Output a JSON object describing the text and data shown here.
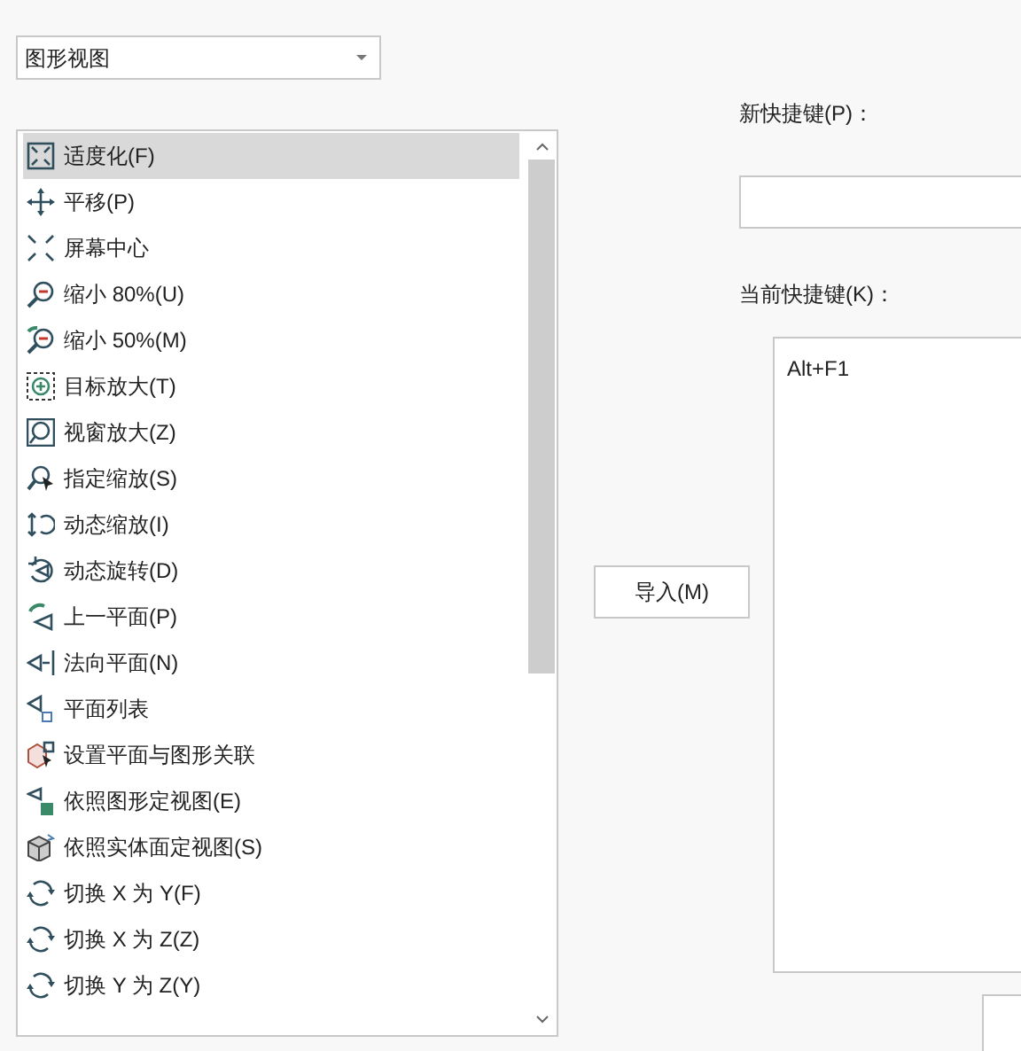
{
  "view_dropdown": {
    "value": "图形视图"
  },
  "command_list": {
    "items": [
      {
        "label": "适度化(F)",
        "selected": true
      },
      {
        "label": "平移(P)",
        "selected": false
      },
      {
        "label": "屏幕中心",
        "selected": false
      },
      {
        "label": "缩小 80%(U)",
        "selected": false
      },
      {
        "label": "缩小 50%(M)",
        "selected": false
      },
      {
        "label": "目标放大(T)",
        "selected": false
      },
      {
        "label": "视窗放大(Z)",
        "selected": false
      },
      {
        "label": "指定缩放(S)",
        "selected": false
      },
      {
        "label": "动态缩放(I)",
        "selected": false
      },
      {
        "label": "动态旋转(D)",
        "selected": false
      },
      {
        "label": "上一平面(P)",
        "selected": false
      },
      {
        "label": "法向平面(N)",
        "selected": false
      },
      {
        "label": "平面列表",
        "selected": false
      },
      {
        "label": "设置平面与图形关联",
        "selected": false
      },
      {
        "label": "依照图形定视图(E)",
        "selected": false
      },
      {
        "label": "依照实体面定视图(S)",
        "selected": false
      },
      {
        "label": "切换 X 为 Y(F)",
        "selected": false
      },
      {
        "label": "切换 X 为 Z(Z)",
        "selected": false
      },
      {
        "label": "切换 Y 为 Z(Y)",
        "selected": false
      }
    ]
  },
  "import_button": {
    "label": "导入(M)"
  },
  "new_shortcut": {
    "label": "新快捷键(P)："
  },
  "current_shortcut": {
    "label": "当前快捷键(K)：",
    "entries": [
      "Alt+F1"
    ]
  }
}
